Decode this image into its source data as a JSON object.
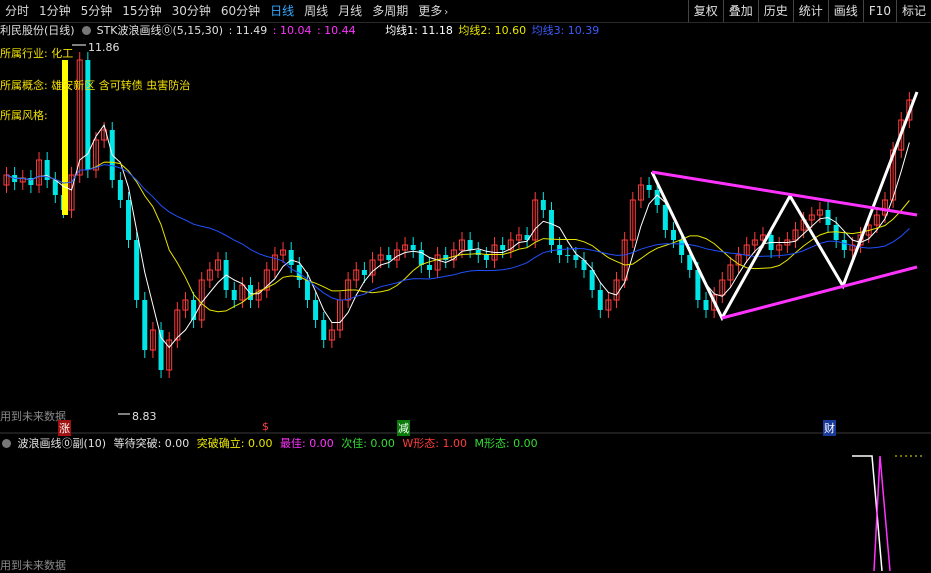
{
  "toolbar": {
    "periods": [
      "分时",
      "1分钟",
      "5分钟",
      "15分钟",
      "30分钟",
      "60分钟",
      "日线",
      "周线",
      "月线",
      "多周期"
    ],
    "active_period": "日线",
    "more_label": "更多",
    "right_buttons": [
      "复权",
      "叠加",
      "历史",
      "统计",
      "画线",
      "F10",
      "标记"
    ]
  },
  "info": {
    "stock_name": "利民股份(日线)",
    "indicator": "STK波浪画线⓪(5,15,30)",
    "v1": ": 11.49",
    "v2": ": 10.04",
    "v3": ": 10.44",
    "ma1": "均线1: 11.18",
    "ma2": "均线2: 10.60",
    "ma3": "均线3: 10.39"
  },
  "overlay": {
    "industry": "所属行业: 化工",
    "concept": "所属概念: 雄安新区  含可转债  虫害防治",
    "style": "所属风格:",
    "high_label": "11.86",
    "low_label": "8.83",
    "future_data_note": "用到未来数据",
    "events": [
      "涨",
      "$",
      "减",
      "财"
    ]
  },
  "sub_panel": {
    "title": "波浪画线⓪副(10)",
    "waiting": "等待突破: 0.00",
    "confirmed": "突破确立: 0.00",
    "best": "最佳: 0.00",
    "second": "次佳: 0.00",
    "w_shape": "W形态: 1.00",
    "m_shape": "M形态: 0.00",
    "future_data_note": "用到未来数据"
  },
  "colors": {
    "up": "#ff3c3c",
    "down": "#00e5e5",
    "ma1": "#ffffff",
    "ma2": "#e8e600",
    "ma3": "#2250ff",
    "channel": "#ff33ff",
    "highlight": "#ffff00"
  }
}
